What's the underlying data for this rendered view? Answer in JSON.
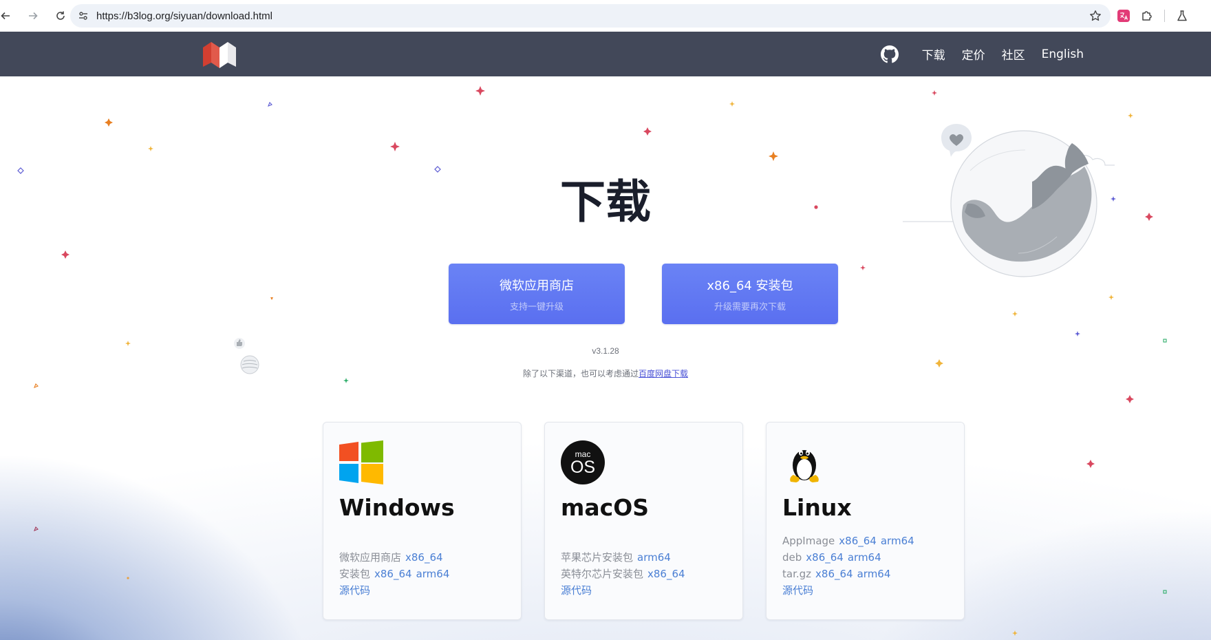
{
  "browser": {
    "url": "https://b3log.org/siyuan/download.html"
  },
  "colors": {
    "header_bg": "#424859",
    "button_bg": "#5a6ff0",
    "link": "#4a7fd4",
    "baidu_link": "#4a52d6"
  },
  "header": {
    "nav": [
      {
        "label": "下载"
      },
      {
        "label": "定价"
      },
      {
        "label": "社区"
      },
      {
        "label": "English"
      }
    ]
  },
  "hero": {
    "title": "下载",
    "buttons": [
      {
        "main": "微软应用商店",
        "sub": "支持一键升级"
      },
      {
        "main": "x86_64 安装包",
        "sub": "升级需要再次下载"
      }
    ],
    "version": "v3.1.28",
    "alt_text": "除了以下渠道，也可以考虑通过",
    "alt_link": "百度网盘下载"
  },
  "platforms": {
    "windows": {
      "title": "Windows",
      "rows": [
        {
          "label": "微软应用商店",
          "links": [
            "x86_64"
          ]
        },
        {
          "label": "安装包",
          "links": [
            "x86_64",
            "arm64"
          ]
        }
      ],
      "source": "源代码"
    },
    "macos": {
      "title": "macOS",
      "icon_text_top": "mac",
      "icon_text_bottom": "OS",
      "rows": [
        {
          "label": "苹果芯片安装包",
          "links": [
            "arm64"
          ]
        },
        {
          "label": "英特尔芯片安装包",
          "links": [
            "x86_64"
          ]
        }
      ],
      "source": "源代码"
    },
    "linux": {
      "title": "Linux",
      "rows": [
        {
          "label": "AppImage",
          "links": [
            "x86_64",
            "arm64"
          ]
        },
        {
          "label": "deb",
          "links": [
            "x86_64",
            "arm64"
          ]
        },
        {
          "label": "tar.gz",
          "links": [
            "x86_64",
            "arm64"
          ]
        }
      ],
      "source": "源代码"
    }
  }
}
